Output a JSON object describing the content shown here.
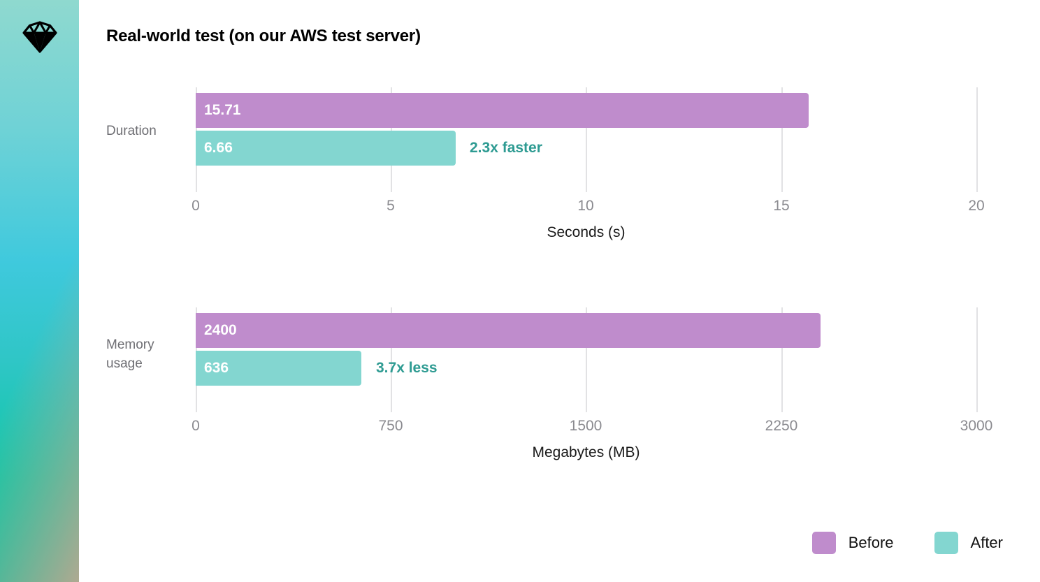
{
  "sidebar": {
    "logo_icon": "diamond-icon"
  },
  "header": {
    "title": "Real-world test (on our AWS test server)"
  },
  "legend": {
    "position": "bottom-right",
    "items": [
      {
        "label": "Before",
        "color": "#bf8ccc",
        "swatch_icon": "color-swatch-icon"
      },
      {
        "label": "After",
        "color": "#83d6d0",
        "swatch_icon": "color-swatch-icon"
      }
    ]
  },
  "charts": [
    {
      "id": "duration",
      "category": "Duration",
      "before_value": "15.71",
      "after_value": "6.66",
      "annotation": "2.3x faster",
      "axis_title": "Seconds (s)",
      "ticks": [
        "0",
        "5",
        "10",
        "15",
        "20"
      ]
    },
    {
      "id": "memory",
      "category": "Memory\nusage",
      "before_value": "2400",
      "after_value": "636",
      "annotation": "3.7x less",
      "axis_title": "Megabytes (MB)",
      "ticks": [
        "0",
        "750",
        "1500",
        "2250",
        "3000"
      ]
    }
  ],
  "chart_data": [
    {
      "type": "bar",
      "orientation": "horizontal",
      "title": "Real-world test (on our AWS test server)",
      "subtitle": "Duration",
      "categories": [
        "Duration"
      ],
      "series": [
        {
          "name": "Before",
          "values": [
            15.71
          ],
          "color": "#bf8ccc"
        },
        {
          "name": "After",
          "values": [
            6.66
          ],
          "color": "#83d6d0"
        }
      ],
      "annotations": [
        "2.3x faster"
      ],
      "xlabel": "Seconds (s)",
      "ylabel": "",
      "xlim": [
        0,
        20
      ],
      "xticks": [
        0,
        5,
        10,
        15,
        20
      ],
      "grid": true,
      "legend": [
        "Before",
        "After"
      ],
      "legend_position": "bottom-right"
    },
    {
      "type": "bar",
      "orientation": "horizontal",
      "title": "Real-world test (on our AWS test server)",
      "subtitle": "Memory usage",
      "categories": [
        "Memory usage"
      ],
      "series": [
        {
          "name": "Before",
          "values": [
            2400
          ],
          "color": "#bf8ccc"
        },
        {
          "name": "After",
          "values": [
            636
          ],
          "color": "#83d6d0"
        }
      ],
      "annotations": [
        "3.7x less"
      ],
      "xlabel": "Megabytes (MB)",
      "ylabel": "",
      "xlim": [
        0,
        3000
      ],
      "xticks": [
        0,
        750,
        1500,
        2250,
        3000
      ],
      "grid": true,
      "legend": [
        "Before",
        "After"
      ],
      "legend_position": "bottom-right"
    }
  ]
}
